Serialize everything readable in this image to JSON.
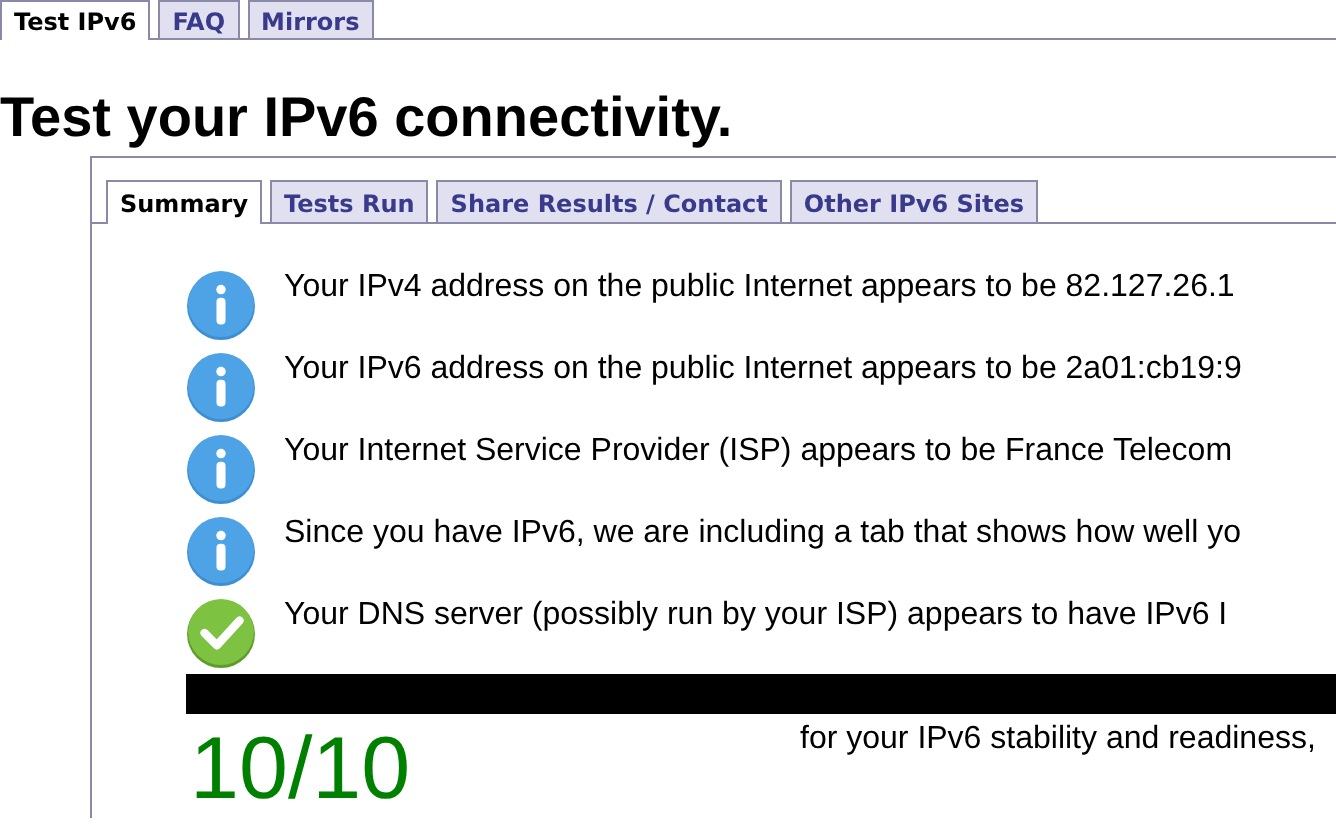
{
  "top_tabs": [
    {
      "label": "Test IPv6",
      "selected": true
    },
    {
      "label": "FAQ",
      "selected": false
    },
    {
      "label": "Mirrors",
      "selected": false
    }
  ],
  "heading": "Test your IPv6 connectivity.",
  "panel_tabs": [
    {
      "label": "Summary",
      "selected": true
    },
    {
      "label": "Tests Run",
      "selected": false
    },
    {
      "label": "Share Results / Contact",
      "selected": false
    },
    {
      "label": "Other IPv6 Sites",
      "selected": false
    }
  ],
  "results": [
    {
      "kind": "info",
      "text": "Your IPv4 address on the public Internet appears to be 82.127.26.1"
    },
    {
      "kind": "info",
      "text": "Your IPv6 address on the public Internet appears to be 2a01:cb19:9"
    },
    {
      "kind": "info",
      "text": "Your Internet Service Provider (ISP) appears to be France Telecom"
    },
    {
      "kind": "info",
      "text": "Since you have IPv6, we are including a tab that shows how well yo"
    },
    {
      "kind": "ok",
      "text": "Your DNS server (possibly run by your ISP) appears to have IPv6 I"
    }
  ],
  "score": "10/10",
  "score_note": "for your IPv6 stability and readiness,"
}
